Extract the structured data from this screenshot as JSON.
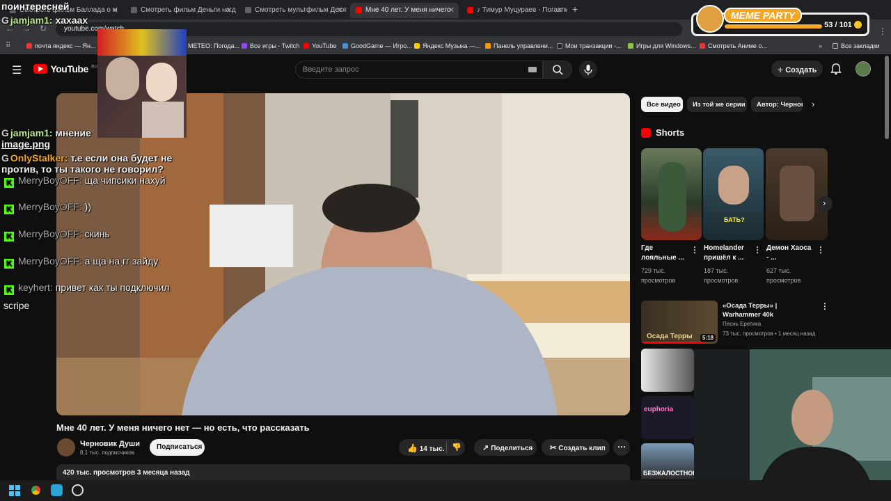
{
  "browser": {
    "tabs": [
      {
        "label": "Смотреть фильм Баллада о м"
      },
      {
        "label": "Смотреть фильм Деньги на д"
      },
      {
        "label": "Смотреть мультфильм Десят"
      },
      {
        "label": "Мне 40 лет. У меня ничего"
      },
      {
        "label": "♪ Тимур Муцураев - Погасли"
      }
    ],
    "url": "youtube.com/watch",
    "bookmarks": [
      "почта яндекс — Ян...",
      "METEO: Погода...",
      "Все игры - Twitch",
      "YouTube",
      "GoodGame — Игро...",
      "Яндекс Музыка —...",
      "Панель управлени...",
      "Мои транзакции -...",
      "Игры для Windows...",
      "Смотреть Аниме о..."
    ],
    "all_bookmarks": "Все закладки"
  },
  "youtube": {
    "logo": "YouTube",
    "logo_region": "RU",
    "search_placeholder": "Введите запрос",
    "create_label": "Создать",
    "video": {
      "title": "Мне 40 лет. У меня ничего нет — но есть, что рассказать",
      "channel": "Черновик Души",
      "subscribers": "8,1 тыс. подписчиков",
      "subscribe": "Подписаться",
      "likes": "14 тыс.",
      "share": "Поделиться",
      "clip": "Создать клип",
      "meta": "420 тыс. просмотров  3 месяца назад"
    },
    "chips": [
      "Все видео",
      "Из той же серии",
      "Автор: Черновик"
    ],
    "shorts_header": "Shorts",
    "shorts": [
      {
        "title": "Где лояльные ...",
        "views": "729 тыс. просмотров",
        "overlay": ""
      },
      {
        "title": "Homelander пришёл к ...",
        "views": "187 тыс. просмотров",
        "overlay": "БАТЬ?"
      },
      {
        "title": "Демон Хаоса - ...",
        "views": "627 тыс. просмотров",
        "overlay": ""
      }
    ],
    "rec": {
      "title": "«Осада Терры» | Warhammer 40k",
      "channel": "Песнь Еретика",
      "meta": "73 тыс. просмотров • 1 месяц назад",
      "duration": "5:18",
      "thumb_text": "Осада Терры"
    },
    "side_thumb_texts": [
      "euphoria",
      "БЕЗЖАЛОСТНОЕ"
    ]
  },
  "overlay": {
    "top_text": "поинтересней",
    "chat": [
      {
        "platform": "G",
        "user": "jamjam1:",
        "text": "хахаах",
        "color": "#b8e986"
      },
      {
        "platform": "G",
        "user": "jamjam1:",
        "text": "мнение",
        "color": "#b8e986"
      },
      {
        "platform": "",
        "user": "",
        "text": "image.png",
        "color": "#ffffff"
      },
      {
        "platform": "G",
        "user": "OnlyStalker:",
        "text": "т.е если она будет не",
        "color": "#f5a623"
      },
      {
        "platform": "",
        "user": "",
        "text": "против, то ты такого не говорил?",
        "color": "#ffffff"
      },
      {
        "platform": "K",
        "user": "MerryBoyOFF:",
        "text": "ща чипсики нахуй",
        "color": "#aaaaaa"
      },
      {
        "platform": "K",
        "user": "MerryBoyOFF:",
        "text": "))",
        "color": "#aaaaaa"
      },
      {
        "platform": "K",
        "user": "MerryBoyOFF:",
        "text": "скинь",
        "color": "#aaaaaa"
      },
      {
        "platform": "K",
        "user": "MerryBoyOFF:",
        "text": "а ща на гг зайду",
        "color": "#aaaaaa"
      },
      {
        "platform": "K",
        "user": "keyhert:",
        "text": "привет как ты подключил",
        "color": "#aaaaaa"
      },
      {
        "platform": "",
        "user": "",
        "text": "scripe",
        "color": "#ffffff"
      }
    ],
    "meme_party": {
      "label": "MEME PARTY",
      "counter": "53 / 101"
    }
  }
}
